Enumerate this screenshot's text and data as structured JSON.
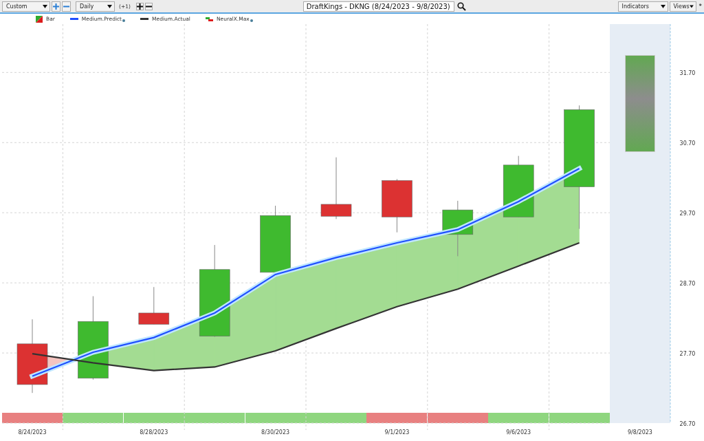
{
  "toolbar": {
    "period_select": "Custom",
    "interval_select": "Daily",
    "offset": "(+1)",
    "symbol_field": "DraftKings - DKNG (8/24/2023 - 9/8/2023)",
    "indicators_select": "Indicators",
    "views_select": "Views",
    "modified_mark": "*"
  },
  "legend": [
    {
      "kind": "bar",
      "label": "Bar",
      "has_dot": false
    },
    {
      "kind": "series",
      "has_dot": true
    },
    {
      "kind": "series",
      "has_dot": false
    },
    {
      "kind": "step",
      "label": "NeuralX.Max",
      "has_dot": true
    }
  ],
  "chart": {
    "chart_data": {
      "type": "line",
      "categories": [
        "8/24/2023",
        null,
        "8/28/2023",
        null,
        "8/30/2023",
        null,
        "9/1/2023",
        null,
        "9/6/2023",
        null,
        "9/8/2023"
      ],
      "ylim": [
        26.7,
        32.39
      ],
      "yticks": [
        {
          "value": 26.7,
          "label": "26.70"
        },
        {
          "value": 27.7,
          "label": "27.70"
        },
        {
          "value": 28.7,
          "label": "28.70"
        },
        {
          "value": 29.7,
          "label": "29.70"
        },
        {
          "value": 30.7,
          "label": "30.70"
        },
        {
          "value": 31.7,
          "label": "31.70"
        }
      ],
      "grid": true,
      "series": [
        {
          "name": "Medium.Predict",
          "color": "#1f4fff",
          "values": [
            27.37,
            27.71,
            27.92,
            28.27,
            28.82,
            29.06,
            29.27,
            29.46,
            29.86,
            30.33,
            null
          ]
        },
        {
          "name": "Medium.Actual",
          "color": "#333333",
          "values": [
            27.69,
            27.56,
            27.45,
            27.5,
            27.73,
            28.05,
            28.36,
            28.61,
            28.94,
            29.27,
            null
          ]
        }
      ]
    },
    "signal_band": [
      {
        "color": "#e88080"
      },
      {
        "color": "#8fd67f"
      },
      {
        "color": "#8fd67f"
      },
      {
        "color": "#8fd67f"
      },
      {
        "color": "#8fd67f"
      },
      {
        "color": "#8fd67f"
      },
      {
        "color": "#e88080"
      },
      {
        "color": "#e88080"
      },
      {
        "color": "#8fd67f"
      },
      {
        "color": "#8fd67f"
      }
    ]
  }
}
